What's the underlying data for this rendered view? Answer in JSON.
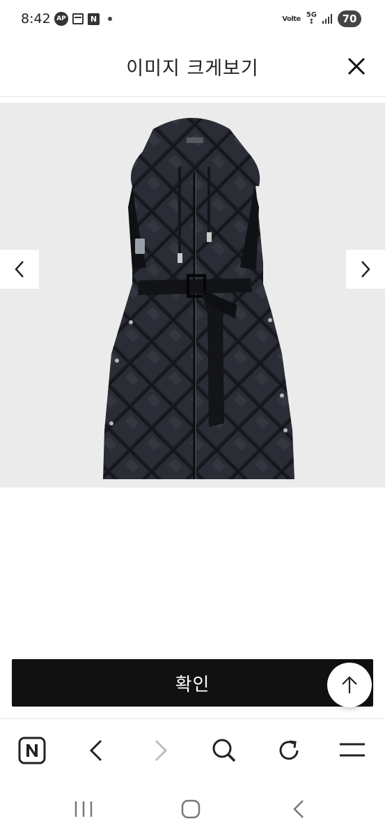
{
  "status_bar": {
    "time": "8:42",
    "notification_icons": [
      "ap-badge-icon",
      "calendar-icon",
      "naver-n-icon",
      "dot-icon"
    ],
    "ap_badge": "AP",
    "naver_badge": "N",
    "volte": "Volte",
    "network": "5G",
    "battery": "70"
  },
  "header": {
    "title": "이미지 크게보기",
    "close_icon": "close-icon"
  },
  "viewer": {
    "background": "#ebebeb",
    "image_subject": "black-quilted-hooded-long-vest",
    "prev_icon": "chevron-left-icon",
    "next_icon": "chevron-right-icon"
  },
  "confirm_button": {
    "label": "확인",
    "color": "#111111"
  },
  "scroll_top_icon": "arrow-up-icon",
  "browser_toolbar": {
    "items": [
      "naver-home-icon",
      "back-icon",
      "forward-icon",
      "search-icon",
      "refresh-icon",
      "menu-icon"
    ]
  },
  "system_nav": {
    "items": [
      "recent-apps-icon",
      "home-icon",
      "system-back-icon"
    ]
  }
}
